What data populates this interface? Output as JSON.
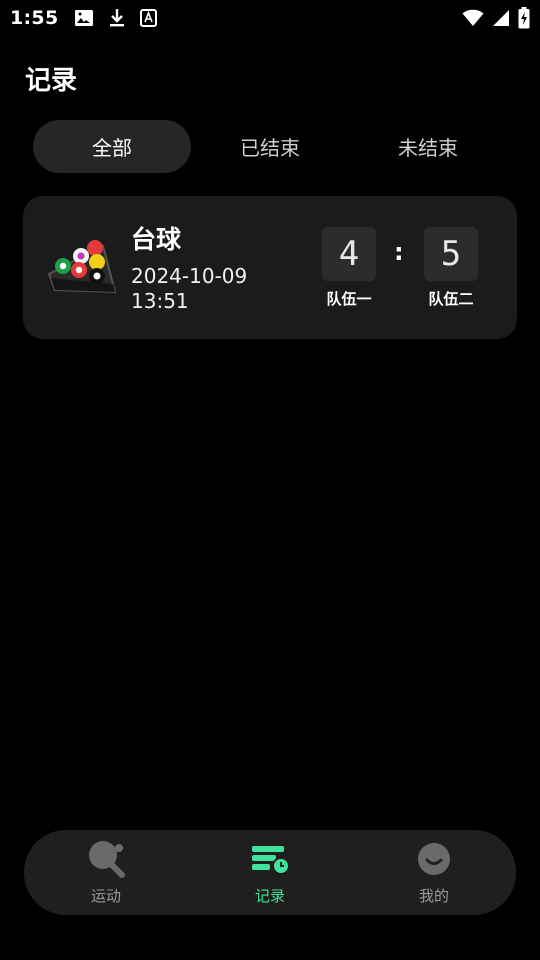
{
  "status_bar": {
    "time": "1:55",
    "left_icons": [
      "image-icon",
      "download-icon",
      "font-a-icon"
    ],
    "right_icons": [
      "wifi-icon",
      "signal-icon",
      "battery-charging-icon"
    ]
  },
  "page": {
    "title": "记录"
  },
  "tabs": [
    {
      "label": "全部",
      "active": true
    },
    {
      "label": "已结束",
      "active": false
    },
    {
      "label": "未结束",
      "active": false
    }
  ],
  "records": [
    {
      "icon": "billiards-icon",
      "sport": "台球",
      "date": "2024-10-09",
      "time": "13:51",
      "score_a": "4",
      "score_b": "5",
      "separator": ":",
      "team_a": "队伍一",
      "team_b": "队伍二"
    }
  ],
  "nav": [
    {
      "label": "运动",
      "icon": "ping-pong-icon",
      "active": false
    },
    {
      "label": "记录",
      "icon": "records-icon",
      "active": true
    },
    {
      "label": "我的",
      "icon": "profile-smile-icon",
      "active": false
    }
  ],
  "colors": {
    "background": "#000000",
    "card": "#1b1b1b",
    "accent": "#3fe39b",
    "tab_active": "#262626",
    "nav_bg": "#1f1f1f"
  }
}
